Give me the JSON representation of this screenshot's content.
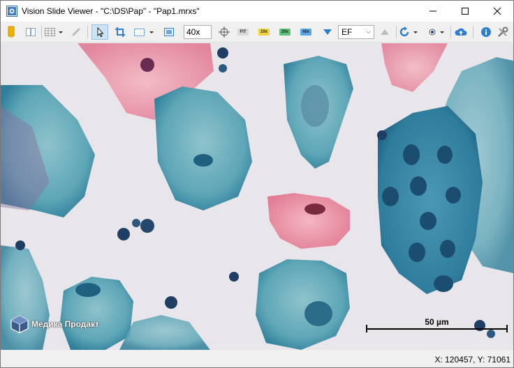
{
  "window": {
    "title": "Vision Slide Viewer - \"C:\\DS\\Pap\" - \"Pap1.mrxs\""
  },
  "toolbar": {
    "zoom_value": "40x",
    "fit_label": "FIT",
    "mag_10_label": "10x",
    "mag_20_label": "20x",
    "mag_40_label": "40x",
    "focus_select_value": "EF",
    "colors": {
      "mag_10": "#f2d23a",
      "mag_20": "#5fc07a",
      "mag_40": "#5aa7e6",
      "accent": "#2f7fd0"
    }
  },
  "viewer": {
    "logo_text": "Медика Продакт",
    "scale_label": "50 µm"
  },
  "status": {
    "coordinates": "X: 120457, Y: 71061"
  }
}
